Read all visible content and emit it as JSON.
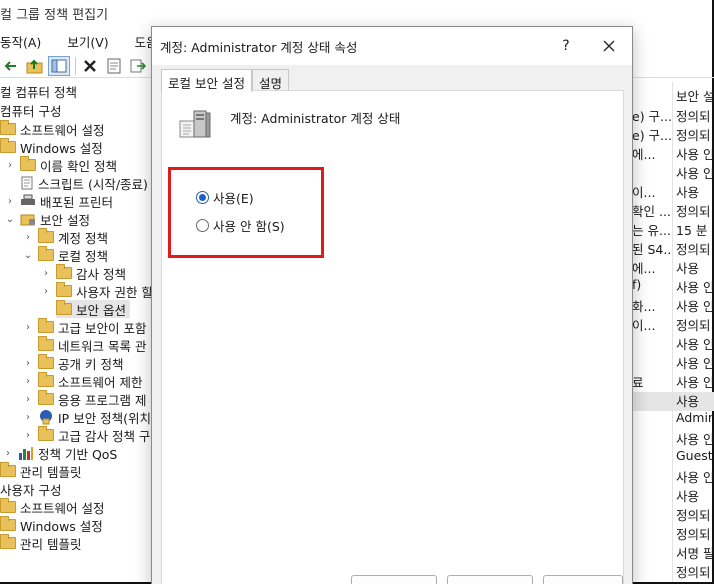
{
  "app": {
    "title": "컬 그룹 정책 편집기"
  },
  "menu": {
    "action": "동작(A)",
    "view": "보기(V)",
    "help": "도움"
  },
  "tree": {
    "items": [
      {
        "label": "컬 컴퓨터 정책"
      },
      {
        "label": "컴퓨터 구성"
      },
      {
        "label": "소프트웨어 설정"
      },
      {
        "label": "Windows 설정"
      },
      {
        "label": "이름 확인 정책"
      },
      {
        "label": "스크립트 (시작/종료)"
      },
      {
        "label": "배포된 프린터"
      },
      {
        "label": "보안 설정"
      },
      {
        "label": "계정 정책"
      },
      {
        "label": "로컬 정책"
      },
      {
        "label": "감사 정책"
      },
      {
        "label": "사용자 권한 할"
      },
      {
        "label": "보안 옵션"
      },
      {
        "label": "고급 보안이 포함"
      },
      {
        "label": "네트워크 목록 관"
      },
      {
        "label": "공개 키 정책"
      },
      {
        "label": "소프트웨어 제한"
      },
      {
        "label": "응용 프로그램 제"
      },
      {
        "label": "IP 보안 정책(위치"
      },
      {
        "label": "고급 감사 정책 구"
      },
      {
        "label": "정책 기반 QoS"
      },
      {
        "label": "관리 템플릿"
      },
      {
        "label": "사용자 구성"
      },
      {
        "label": "소프트웨어 설정"
      },
      {
        "label": "Windows 설정"
      },
      {
        "label": "관리 템플릿"
      }
    ]
  },
  "right_list": {
    "header": "보안 설",
    "col_a": [
      "e) 구...",
      "e) 구...",
      "에...",
      "",
      "이...",
      "확인 ...",
      "는 유...",
      "된 S4...",
      "에...",
      "f)",
      "화...",
      "이...",
      "",
      "",
      "료",
      "",
      "",
      "",
      "",
      "",
      "",
      "",
      "",
      "",
      "",
      ""
    ],
    "col_b": [
      "정의되",
      "정의되",
      "사용 인",
      "사용 인",
      "사용",
      "정의되",
      "15 분",
      "정의되",
      "사용",
      "사용 인",
      "사용 인",
      "정의되",
      "사용 인",
      "사용 인",
      "사용 인",
      "사용",
      "Admin",
      "사용 인",
      "Guest",
      "사용 인",
      "사용",
      "정의되",
      "정의되",
      "서명 필",
      "정의되",
      ""
    ]
  },
  "dialog": {
    "title": "계정: Administrator 계정 상태 속성",
    "help": "?",
    "tabs": [
      "로컬 보안 설정",
      "설명"
    ],
    "policy_name": "계정: Administrator 계정 상태",
    "options": {
      "enabled": "사용(E)",
      "disabled": "사용 안 함(S)"
    },
    "selected": "enabled",
    "highlight_color": "#e01b1b",
    "accent_color": "#1f5fbf"
  }
}
